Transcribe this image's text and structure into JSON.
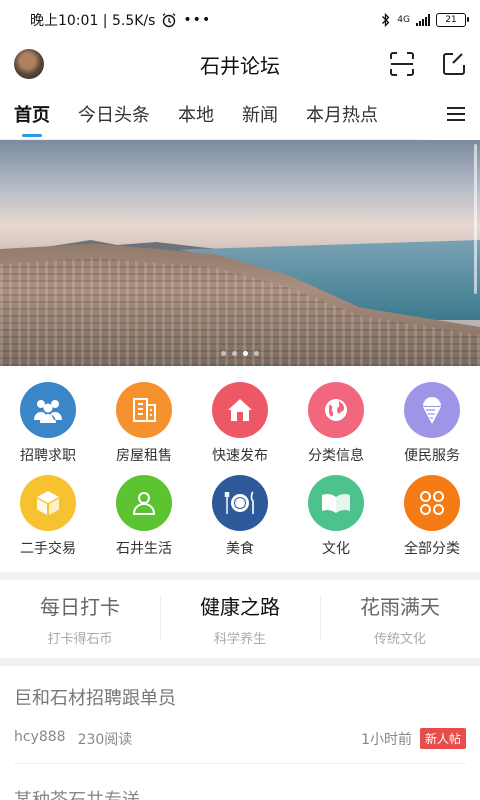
{
  "status_bar": {
    "time_speed": "晚上10:01 | 5.5K/s",
    "network": "4G",
    "battery": "21"
  },
  "header": {
    "title": "石井论坛"
  },
  "tabs": [
    {
      "label": "首页",
      "active": true
    },
    {
      "label": "今日头条",
      "active": false
    },
    {
      "label": "本地",
      "active": false
    },
    {
      "label": "新闻",
      "active": false
    },
    {
      "label": "本月热点",
      "active": false
    }
  ],
  "banner": {
    "slide_count": 4,
    "active_slide": 2
  },
  "categories": [
    {
      "label": "招聘求职",
      "icon": "people-icon",
      "color": "#3a86c8"
    },
    {
      "label": "房屋租售",
      "icon": "building-icon",
      "color": "#f5922f"
    },
    {
      "label": "快速发布",
      "icon": "house-icon",
      "color": "#ee5866"
    },
    {
      "label": "分类信息",
      "icon": "globe-icon",
      "color": "#f2667e"
    },
    {
      "label": "便民服务",
      "icon": "icecream-icon",
      "color": "#9d95e8"
    },
    {
      "label": "二手交易",
      "icon": "box-icon",
      "color": "#f6c22f"
    },
    {
      "label": "石井生活",
      "icon": "person-icon",
      "color": "#5cc431"
    },
    {
      "label": "美食",
      "icon": "plate-icon",
      "color": "#2e5a9c"
    },
    {
      "label": "文化",
      "icon": "book-icon",
      "color": "#4cc38d"
    },
    {
      "label": "全部分类",
      "icon": "grid-icon",
      "color": "#f57b14"
    }
  ],
  "topics": [
    {
      "title": "每日打卡",
      "sub": "打卡得石币"
    },
    {
      "title": "健康之路",
      "sub": "科学养生"
    },
    {
      "title": "花雨满天",
      "sub": "传统文化"
    }
  ],
  "posts": [
    {
      "title": "巨和石材招聘跟单员",
      "author": "hcy888",
      "reads": "230阅读",
      "time": "1小时前",
      "badge": "新人帖"
    },
    {
      "title": "某种茶石井专送"
    }
  ]
}
